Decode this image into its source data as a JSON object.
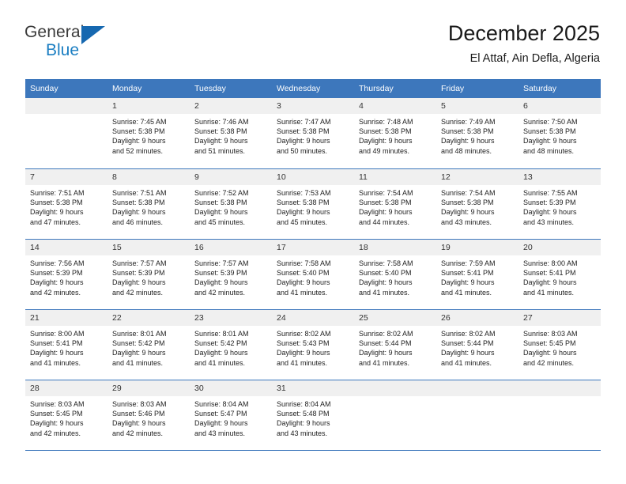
{
  "brand": {
    "name_part1": "General",
    "name_part2": "Blue",
    "accent_color": "#1b7ec2",
    "triangle_color": "#1668b0"
  },
  "header": {
    "title": "December 2025",
    "subtitle": "El Attaf, Ain Defla, Algeria"
  },
  "theme": {
    "header_row_color": "#3d77bc",
    "day_banner_color": "#f0f0f0",
    "text_color": "#222222"
  },
  "calendar": {
    "weekdays": [
      "Sunday",
      "Monday",
      "Tuesday",
      "Wednesday",
      "Thursday",
      "Friday",
      "Saturday"
    ],
    "weeks": [
      [
        {
          "day": "",
          "empty": true
        },
        {
          "day": "1",
          "sunrise": "Sunrise: 7:45 AM",
          "sunset": "Sunset: 5:38 PM",
          "daylight_line1": "Daylight: 9 hours",
          "daylight_line2": "and 52 minutes."
        },
        {
          "day": "2",
          "sunrise": "Sunrise: 7:46 AM",
          "sunset": "Sunset: 5:38 PM",
          "daylight_line1": "Daylight: 9 hours",
          "daylight_line2": "and 51 minutes."
        },
        {
          "day": "3",
          "sunrise": "Sunrise: 7:47 AM",
          "sunset": "Sunset: 5:38 PM",
          "daylight_line1": "Daylight: 9 hours",
          "daylight_line2": "and 50 minutes."
        },
        {
          "day": "4",
          "sunrise": "Sunrise: 7:48 AM",
          "sunset": "Sunset: 5:38 PM",
          "daylight_line1": "Daylight: 9 hours",
          "daylight_line2": "and 49 minutes."
        },
        {
          "day": "5",
          "sunrise": "Sunrise: 7:49 AM",
          "sunset": "Sunset: 5:38 PM",
          "daylight_line1": "Daylight: 9 hours",
          "daylight_line2": "and 48 minutes."
        },
        {
          "day": "6",
          "sunrise": "Sunrise: 7:50 AM",
          "sunset": "Sunset: 5:38 PM",
          "daylight_line1": "Daylight: 9 hours",
          "daylight_line2": "and 48 minutes."
        }
      ],
      [
        {
          "day": "7",
          "sunrise": "Sunrise: 7:51 AM",
          "sunset": "Sunset: 5:38 PM",
          "daylight_line1": "Daylight: 9 hours",
          "daylight_line2": "and 47 minutes."
        },
        {
          "day": "8",
          "sunrise": "Sunrise: 7:51 AM",
          "sunset": "Sunset: 5:38 PM",
          "daylight_line1": "Daylight: 9 hours",
          "daylight_line2": "and 46 minutes."
        },
        {
          "day": "9",
          "sunrise": "Sunrise: 7:52 AM",
          "sunset": "Sunset: 5:38 PM",
          "daylight_line1": "Daylight: 9 hours",
          "daylight_line2": "and 45 minutes."
        },
        {
          "day": "10",
          "sunrise": "Sunrise: 7:53 AM",
          "sunset": "Sunset: 5:38 PM",
          "daylight_line1": "Daylight: 9 hours",
          "daylight_line2": "and 45 minutes."
        },
        {
          "day": "11",
          "sunrise": "Sunrise: 7:54 AM",
          "sunset": "Sunset: 5:38 PM",
          "daylight_line1": "Daylight: 9 hours",
          "daylight_line2": "and 44 minutes."
        },
        {
          "day": "12",
          "sunrise": "Sunrise: 7:54 AM",
          "sunset": "Sunset: 5:38 PM",
          "daylight_line1": "Daylight: 9 hours",
          "daylight_line2": "and 43 minutes."
        },
        {
          "day": "13",
          "sunrise": "Sunrise: 7:55 AM",
          "sunset": "Sunset: 5:39 PM",
          "daylight_line1": "Daylight: 9 hours",
          "daylight_line2": "and 43 minutes."
        }
      ],
      [
        {
          "day": "14",
          "sunrise": "Sunrise: 7:56 AM",
          "sunset": "Sunset: 5:39 PM",
          "daylight_line1": "Daylight: 9 hours",
          "daylight_line2": "and 42 minutes."
        },
        {
          "day": "15",
          "sunrise": "Sunrise: 7:57 AM",
          "sunset": "Sunset: 5:39 PM",
          "daylight_line1": "Daylight: 9 hours",
          "daylight_line2": "and 42 minutes."
        },
        {
          "day": "16",
          "sunrise": "Sunrise: 7:57 AM",
          "sunset": "Sunset: 5:39 PM",
          "daylight_line1": "Daylight: 9 hours",
          "daylight_line2": "and 42 minutes."
        },
        {
          "day": "17",
          "sunrise": "Sunrise: 7:58 AM",
          "sunset": "Sunset: 5:40 PM",
          "daylight_line1": "Daylight: 9 hours",
          "daylight_line2": "and 41 minutes."
        },
        {
          "day": "18",
          "sunrise": "Sunrise: 7:58 AM",
          "sunset": "Sunset: 5:40 PM",
          "daylight_line1": "Daylight: 9 hours",
          "daylight_line2": "and 41 minutes."
        },
        {
          "day": "19",
          "sunrise": "Sunrise: 7:59 AM",
          "sunset": "Sunset: 5:41 PM",
          "daylight_line1": "Daylight: 9 hours",
          "daylight_line2": "and 41 minutes."
        },
        {
          "day": "20",
          "sunrise": "Sunrise: 8:00 AM",
          "sunset": "Sunset: 5:41 PM",
          "daylight_line1": "Daylight: 9 hours",
          "daylight_line2": "and 41 minutes."
        }
      ],
      [
        {
          "day": "21",
          "sunrise": "Sunrise: 8:00 AM",
          "sunset": "Sunset: 5:41 PM",
          "daylight_line1": "Daylight: 9 hours",
          "daylight_line2": "and 41 minutes."
        },
        {
          "day": "22",
          "sunrise": "Sunrise: 8:01 AM",
          "sunset": "Sunset: 5:42 PM",
          "daylight_line1": "Daylight: 9 hours",
          "daylight_line2": "and 41 minutes."
        },
        {
          "day": "23",
          "sunrise": "Sunrise: 8:01 AM",
          "sunset": "Sunset: 5:42 PM",
          "daylight_line1": "Daylight: 9 hours",
          "daylight_line2": "and 41 minutes."
        },
        {
          "day": "24",
          "sunrise": "Sunrise: 8:02 AM",
          "sunset": "Sunset: 5:43 PM",
          "daylight_line1": "Daylight: 9 hours",
          "daylight_line2": "and 41 minutes."
        },
        {
          "day": "25",
          "sunrise": "Sunrise: 8:02 AM",
          "sunset": "Sunset: 5:44 PM",
          "daylight_line1": "Daylight: 9 hours",
          "daylight_line2": "and 41 minutes."
        },
        {
          "day": "26",
          "sunrise": "Sunrise: 8:02 AM",
          "sunset": "Sunset: 5:44 PM",
          "daylight_line1": "Daylight: 9 hours",
          "daylight_line2": "and 41 minutes."
        },
        {
          "day": "27",
          "sunrise": "Sunrise: 8:03 AM",
          "sunset": "Sunset: 5:45 PM",
          "daylight_line1": "Daylight: 9 hours",
          "daylight_line2": "and 42 minutes."
        }
      ],
      [
        {
          "day": "28",
          "sunrise": "Sunrise: 8:03 AM",
          "sunset": "Sunset: 5:45 PM",
          "daylight_line1": "Daylight: 9 hours",
          "daylight_line2": "and 42 minutes."
        },
        {
          "day": "29",
          "sunrise": "Sunrise: 8:03 AM",
          "sunset": "Sunset: 5:46 PM",
          "daylight_line1": "Daylight: 9 hours",
          "daylight_line2": "and 42 minutes."
        },
        {
          "day": "30",
          "sunrise": "Sunrise: 8:04 AM",
          "sunset": "Sunset: 5:47 PM",
          "daylight_line1": "Daylight: 9 hours",
          "daylight_line2": "and 43 minutes."
        },
        {
          "day": "31",
          "sunrise": "Sunrise: 8:04 AM",
          "sunset": "Sunset: 5:48 PM",
          "daylight_line1": "Daylight: 9 hours",
          "daylight_line2": "and 43 minutes."
        },
        {
          "day": "",
          "empty": true
        },
        {
          "day": "",
          "empty": true
        },
        {
          "day": "",
          "empty": true
        }
      ]
    ]
  }
}
